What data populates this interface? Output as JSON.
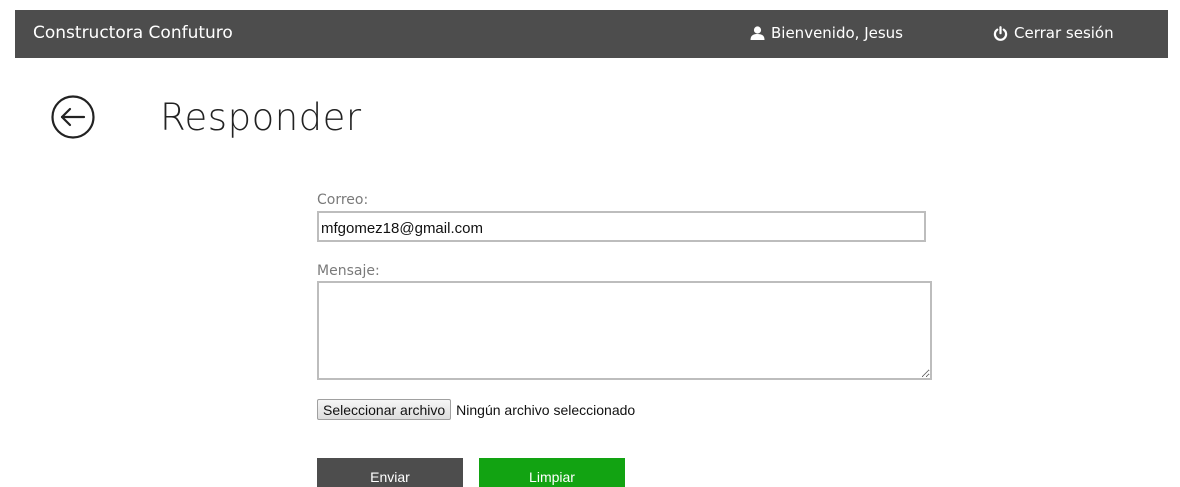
{
  "header": {
    "brand": "Constructora Confuturo",
    "welcome": "Bienvenido, Jesus",
    "logout": "Cerrar sesión"
  },
  "page": {
    "title": "Responder"
  },
  "form": {
    "email_label": "Correo:",
    "email_value": "mfgomez18@gmail.com",
    "message_label": "Mensaje:",
    "message_value": "",
    "file_button": "Seleccionar archivo",
    "file_status": "Ningún archivo seleccionado",
    "send_label": "Enviar",
    "clear_label": "Limpiar"
  },
  "icons": {
    "user": "user-icon",
    "power": "power-icon",
    "back": "back-arrow-circle-icon"
  },
  "colors": {
    "header_bg": "#4d4d4d",
    "send_bg": "#4d4d4d",
    "clear_bg": "#12a312"
  }
}
